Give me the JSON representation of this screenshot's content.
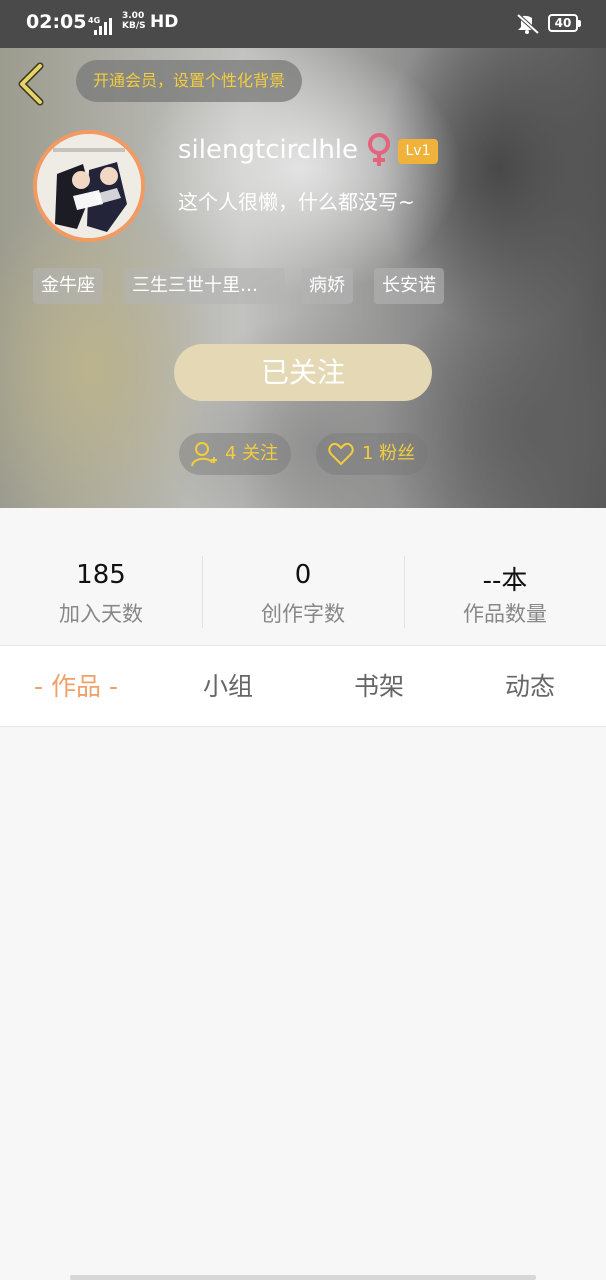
{
  "status_bar": {
    "time": "02:05",
    "network": "4G",
    "speed": "3.00",
    "speed_unit": "KB/S",
    "hd": "HD",
    "battery": "40"
  },
  "header": {
    "vip_text": "开通会员，设置个性化背景"
  },
  "profile": {
    "username": "silengtcirclhle",
    "level": "Lv1",
    "bio": "这个人很懒，什么都没写~",
    "tags": [
      "金牛座",
      "三生三世十里…",
      "病娇",
      "长安诺"
    ],
    "follow_button": "已关注",
    "following": "4 关注",
    "fans": "1 粉丝"
  },
  "stats": [
    {
      "value": "185",
      "label": "加入天数"
    },
    {
      "value": "0",
      "label": "创作字数"
    },
    {
      "value": "--本",
      "label": "作品数量"
    }
  ],
  "tabs": [
    {
      "label": "- 作品 -",
      "active": true
    },
    {
      "label": "小组",
      "active": false
    },
    {
      "label": "书架",
      "active": false
    },
    {
      "label": "动态",
      "active": false
    }
  ],
  "colors": {
    "accent": "#f0a06a",
    "gold": "#f3cd3e",
    "level_badge": "#efb23a",
    "follow_button": "#e4d9b4"
  }
}
